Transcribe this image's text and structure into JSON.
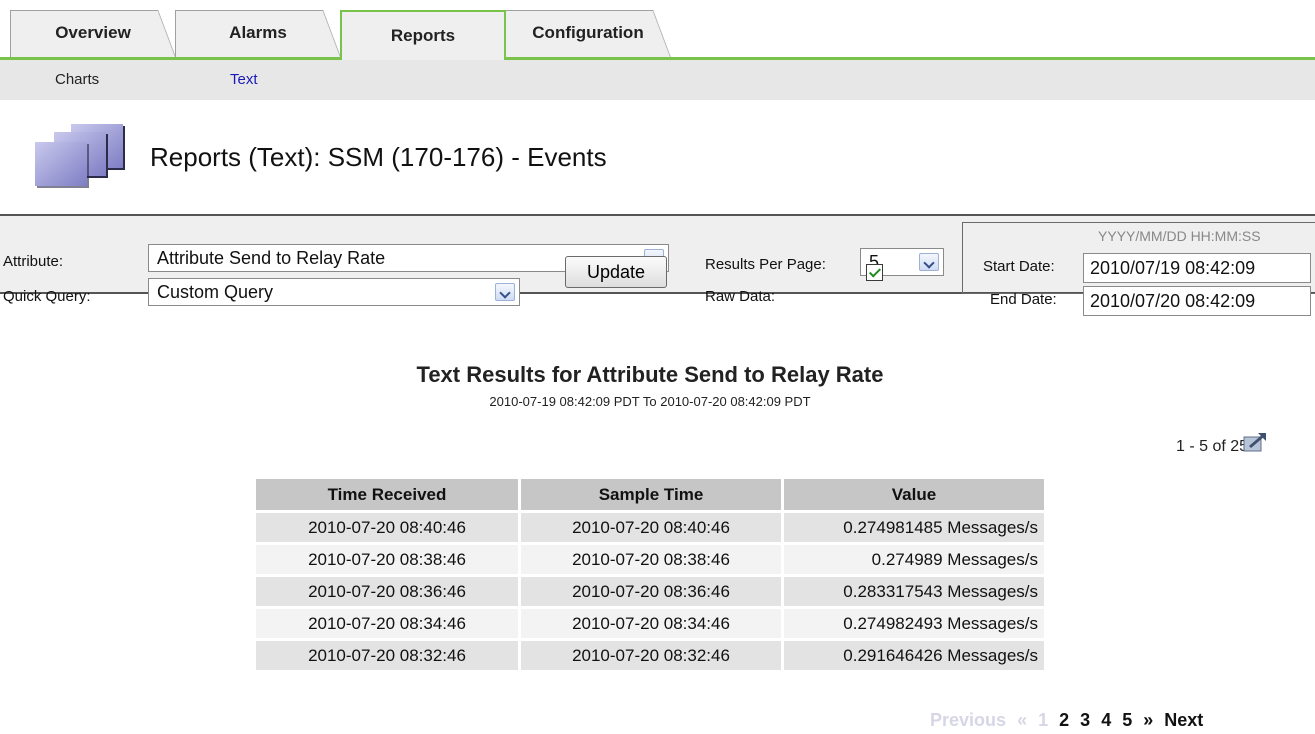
{
  "tabs": [
    "Overview",
    "Alarms",
    "Reports",
    "Configuration"
  ],
  "active_tab": "Reports",
  "subnav": {
    "charts": "Charts",
    "text": "Text"
  },
  "page_title": "Reports (Text): SSM (170-176) - Events",
  "filter": {
    "attribute_label": "Attribute:",
    "attribute_value": "Attribute Send to Relay Rate",
    "quick_query_label": "Quick Query:",
    "quick_query_value": "Custom Query",
    "update_label": "Update",
    "results_per_page_label": "Results Per Page:",
    "results_per_page_value": "5",
    "raw_data_label": "Raw Data:",
    "raw_data_checked": true,
    "date_format_hint": "YYYY/MM/DD HH:MM:SS",
    "start_date_label": "Start Date:",
    "start_date_value": "2010/07/19 08:42:09",
    "end_date_label": "End Date:",
    "end_date_value": "2010/07/20 08:42:09"
  },
  "results": {
    "title": "Text Results for Attribute Send to Relay Rate",
    "subtitle": "2010-07-19 08:42:09 PDT To 2010-07-20 08:42:09 PDT",
    "count": "1 - 5 of 254",
    "columns": [
      "Time Received",
      "Sample Time",
      "Value"
    ],
    "rows": [
      [
        "2010-07-20 08:40:46",
        "2010-07-20 08:40:46",
        "0.274981485 Messages/s"
      ],
      [
        "2010-07-20 08:38:46",
        "2010-07-20 08:38:46",
        "0.274989 Messages/s"
      ],
      [
        "2010-07-20 08:36:46",
        "2010-07-20 08:36:46",
        "0.283317543 Messages/s"
      ],
      [
        "2010-07-20 08:34:46",
        "2010-07-20 08:34:46",
        "0.274982493 Messages/s"
      ],
      [
        "2010-07-20 08:32:46",
        "2010-07-20 08:32:46",
        "0.291646426 Messages/s"
      ]
    ]
  },
  "pager": {
    "previous": "Previous",
    "prev_arrow": "«",
    "pages": [
      "1",
      "2",
      "3",
      "4",
      "5"
    ],
    "next_arrow": "»",
    "next": "Next"
  },
  "colors": {
    "accent": "#79c34b",
    "link": "#1a1ab8",
    "header_bg": "#c6c6c6"
  },
  "icons": [
    "report-pages-icon",
    "export-icon",
    "dropdown-arrow-icon",
    "checkbox-checked-icon"
  ]
}
